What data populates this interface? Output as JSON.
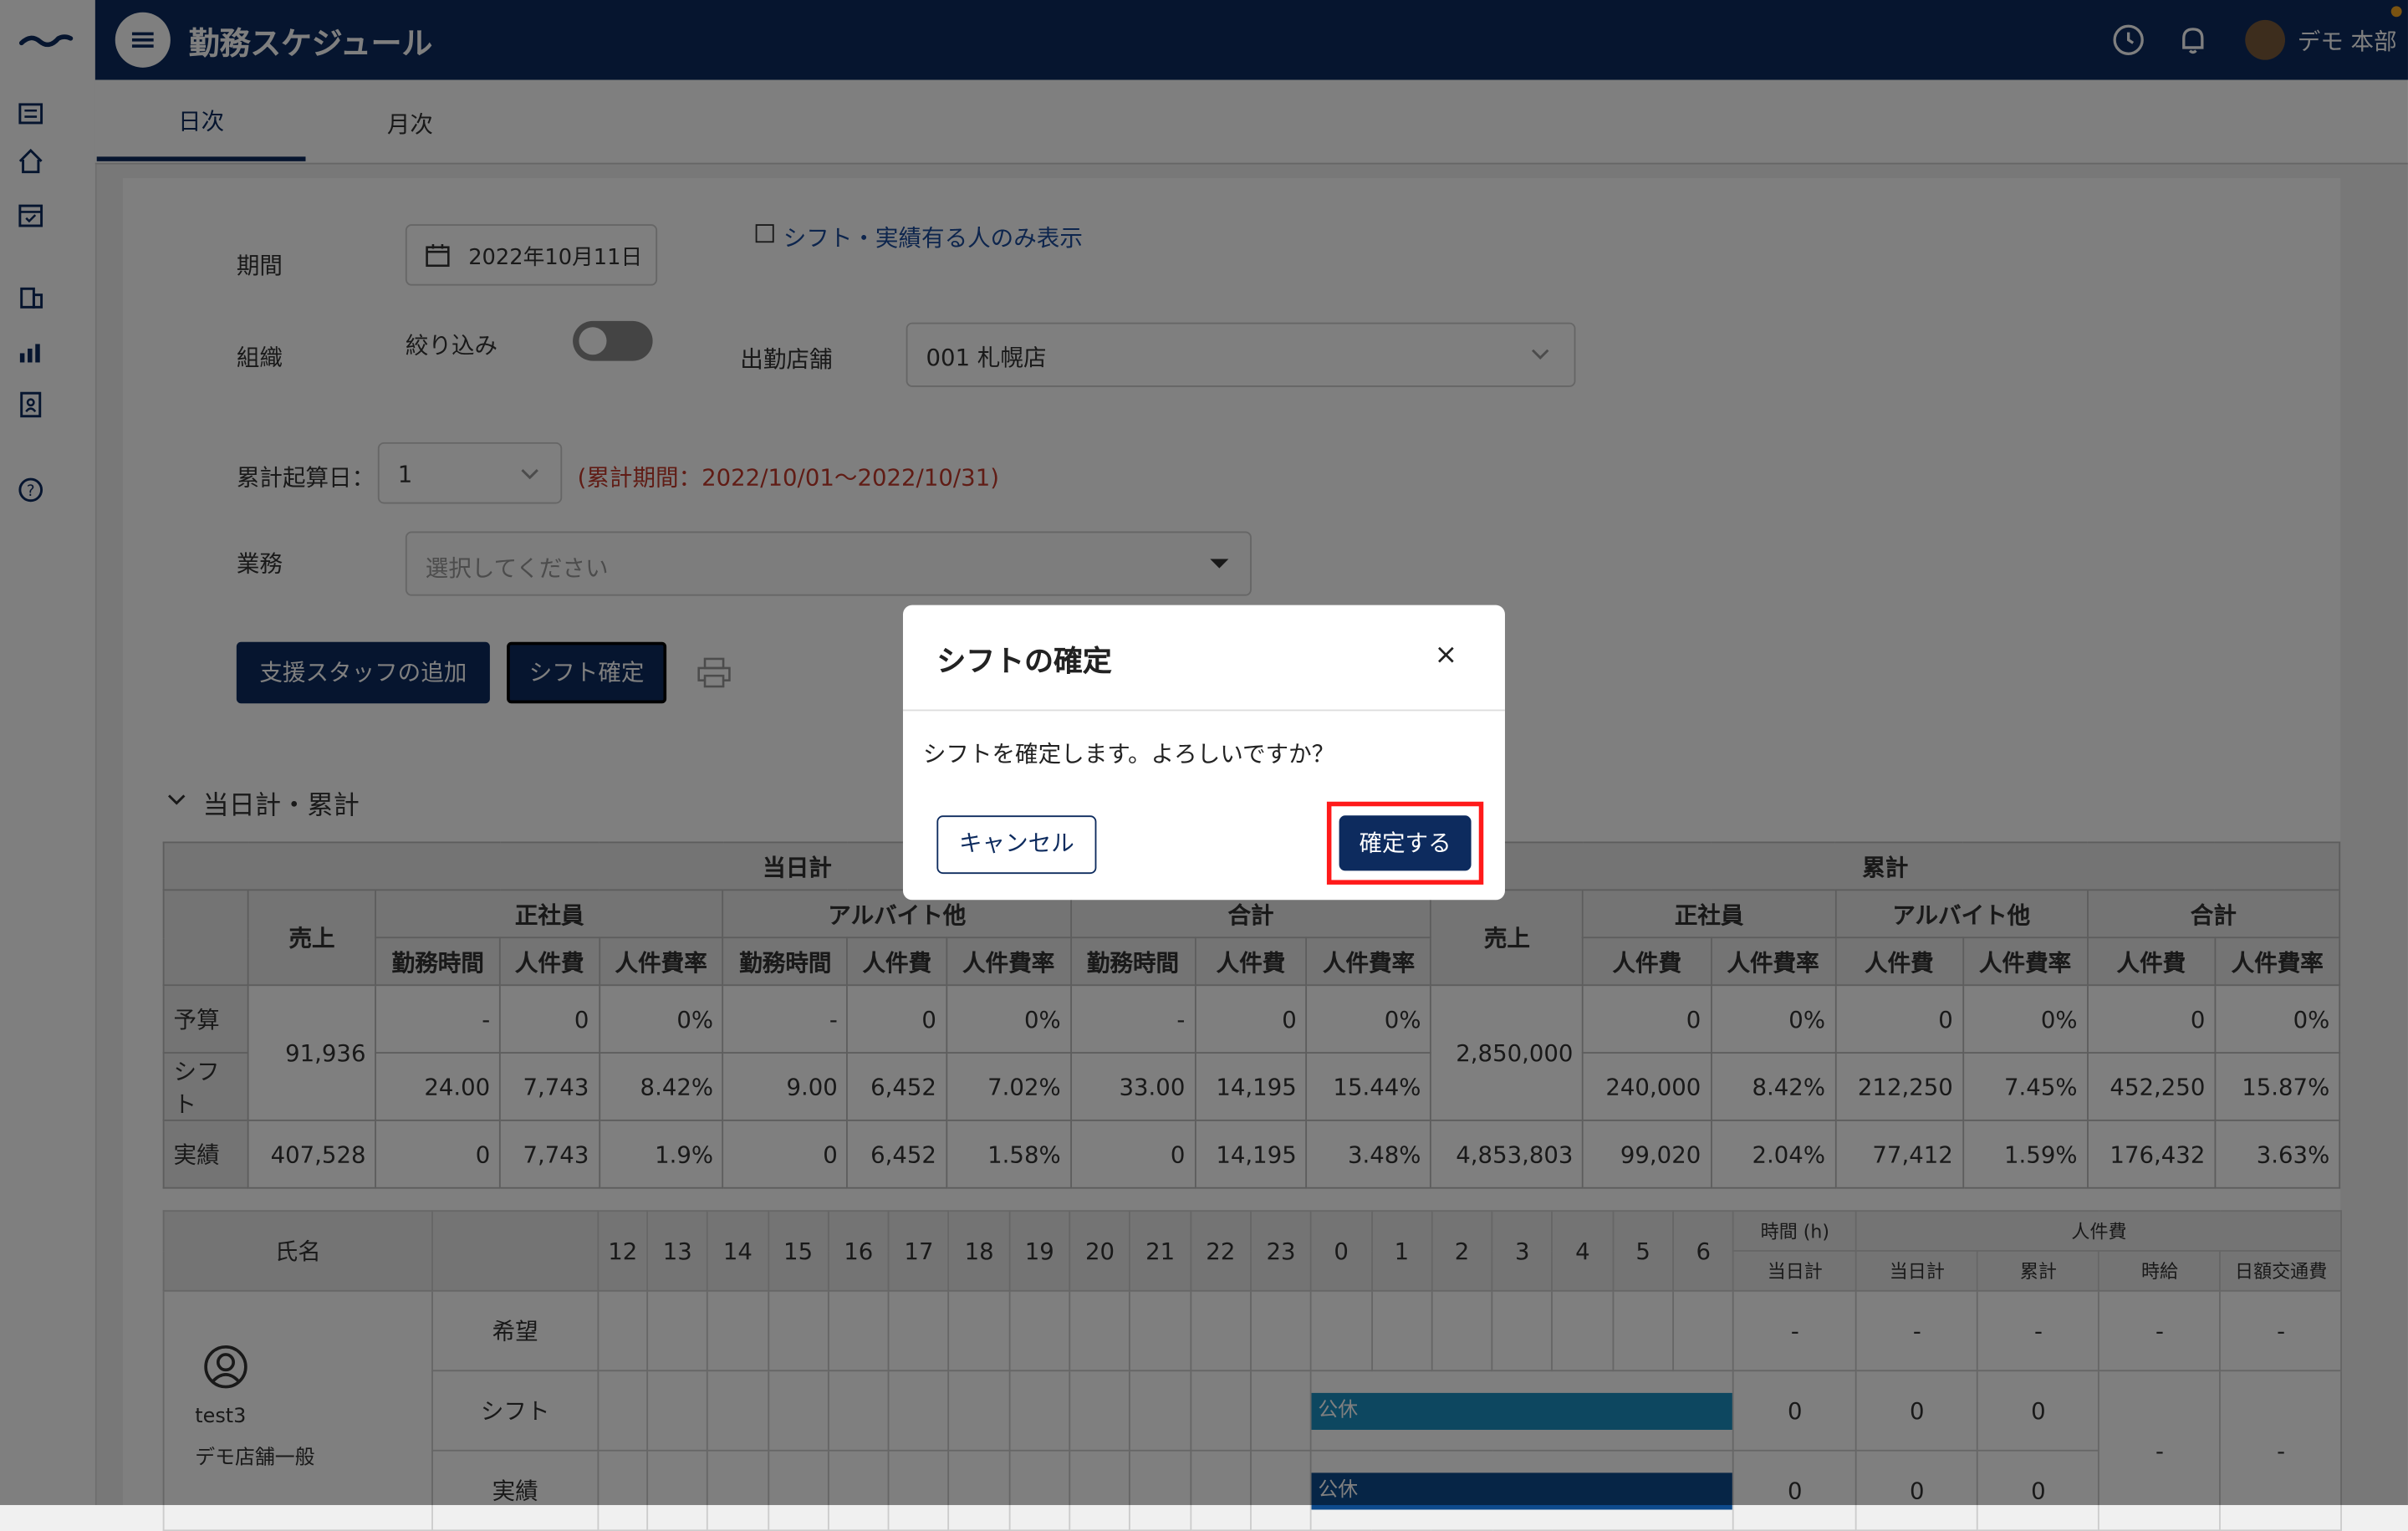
{
  "header": {
    "title": "勤務スケジュール",
    "user_name": "デモ 本部"
  },
  "tabs": [
    {
      "label": "日次",
      "active": true
    },
    {
      "label": "月次",
      "active": false
    }
  ],
  "filters": {
    "period_label": "期間",
    "period_value": "2022年10月11日",
    "shift_only_label": "シフト・実績有る人のみ表示",
    "org_label": "組織",
    "narrow_label": "絞り込み",
    "store_label": "出勤店舗",
    "store_value": "001 札幌店",
    "cumulative_label": "累計起算日：",
    "cumulative_value": "1",
    "cumulative_period": "(累計期間：2022/10/01～2022/10/31)",
    "task_label": "業務",
    "task_placeholder": "選択してください"
  },
  "actions": {
    "add_staff": "支援スタッフの追加",
    "confirm_shift": "シフト確定"
  },
  "summary": {
    "section_title": "当日計・累計",
    "daily_header": "当日計",
    "cumulative_header": "累計",
    "sales": "売上",
    "regular": "正社員",
    "part_time": "アルバイト他",
    "total": "合計",
    "hours": "勤務時間",
    "labor_cost": "人件費",
    "labor_rate": "人件費率",
    "rows": [
      {
        "label": "予算",
        "d_reg_h": "-",
        "d_reg_c": "0",
        "d_reg_r": "0%",
        "d_pt_h": "-",
        "d_pt_c": "0",
        "d_pt_r": "0%",
        "d_tot_h": "-",
        "d_tot_c": "0",
        "d_tot_r": "0%",
        "c_reg_c": "0",
        "c_reg_r": "0%",
        "c_pt_c": "0",
        "c_pt_r": "0%",
        "c_tot_c": "0",
        "c_tot_r": "0%"
      },
      {
        "label": "シフト",
        "d_reg_h": "24.00",
        "d_reg_c": "7,743",
        "d_reg_r": "8.42%",
        "d_pt_h": "9.00",
        "d_pt_c": "6,452",
        "d_pt_r": "7.02%",
        "d_tot_h": "33.00",
        "d_tot_c": "14,195",
        "d_tot_r": "15.44%",
        "c_reg_c": "240,000",
        "c_reg_r": "8.42%",
        "c_pt_c": "212,250",
        "c_pt_r": "7.45%",
        "c_tot_c": "452,250",
        "c_tot_r": "15.87%"
      },
      {
        "label": "実績",
        "d_sales": "407,528",
        "d_reg_h": "0",
        "d_reg_c": "7,743",
        "d_reg_r": "1.9%",
        "d_pt_h": "0",
        "d_pt_c": "6,452",
        "d_pt_r": "1.58%",
        "d_tot_h": "0",
        "d_tot_c": "14,195",
        "d_tot_r": "3.48%",
        "c_sales": "4,853,803",
        "c_reg_c": "99,020",
        "c_reg_r": "2.04%",
        "c_pt_c": "77,412",
        "c_pt_r": "1.59%",
        "c_tot_c": "176,432",
        "c_tot_r": "3.63%"
      }
    ],
    "daily_sales_budget": "91,936",
    "cumulative_sales_budget": "2,850,000"
  },
  "schedule": {
    "name_header": "氏名",
    "hours": [
      "12",
      "13",
      "14",
      "15",
      "16",
      "17",
      "18",
      "19",
      "20",
      "21",
      "22",
      "23",
      "0",
      "1",
      "2",
      "3",
      "4",
      "5",
      "6"
    ],
    "time_header": "時間 (h)",
    "cost_header": "人件費",
    "day_total": "当日計",
    "cumulative": "累計",
    "hourly": "時給",
    "transport": "日額交通費",
    "employee": {
      "name": "test3",
      "role": "デモ店舗一般"
    },
    "rows": [
      {
        "label": "希望",
        "h": "-",
        "c": "-",
        "cum": "-",
        "hourly": "-",
        "transport": "-"
      },
      {
        "label": "シフト",
        "bar": "公休",
        "h": "0",
        "c": "0",
        "cum": "0"
      },
      {
        "label": "実績",
        "bar": "公休",
        "h": "0",
        "c": "0",
        "cum": "0"
      }
    ],
    "merged_hourly": "-",
    "merged_transport": "-"
  },
  "modal": {
    "title": "シフトの確定",
    "close": "×",
    "message": "シフトを確定します。よろしいですか？",
    "cancel": "キャンセル",
    "confirm": "確定する"
  },
  "colors": {
    "primary": "#0d2b5e",
    "bar_shift": "#1a8fc1",
    "bar_actual": "#0d4a8c",
    "highlight": "#ff1a1a"
  }
}
